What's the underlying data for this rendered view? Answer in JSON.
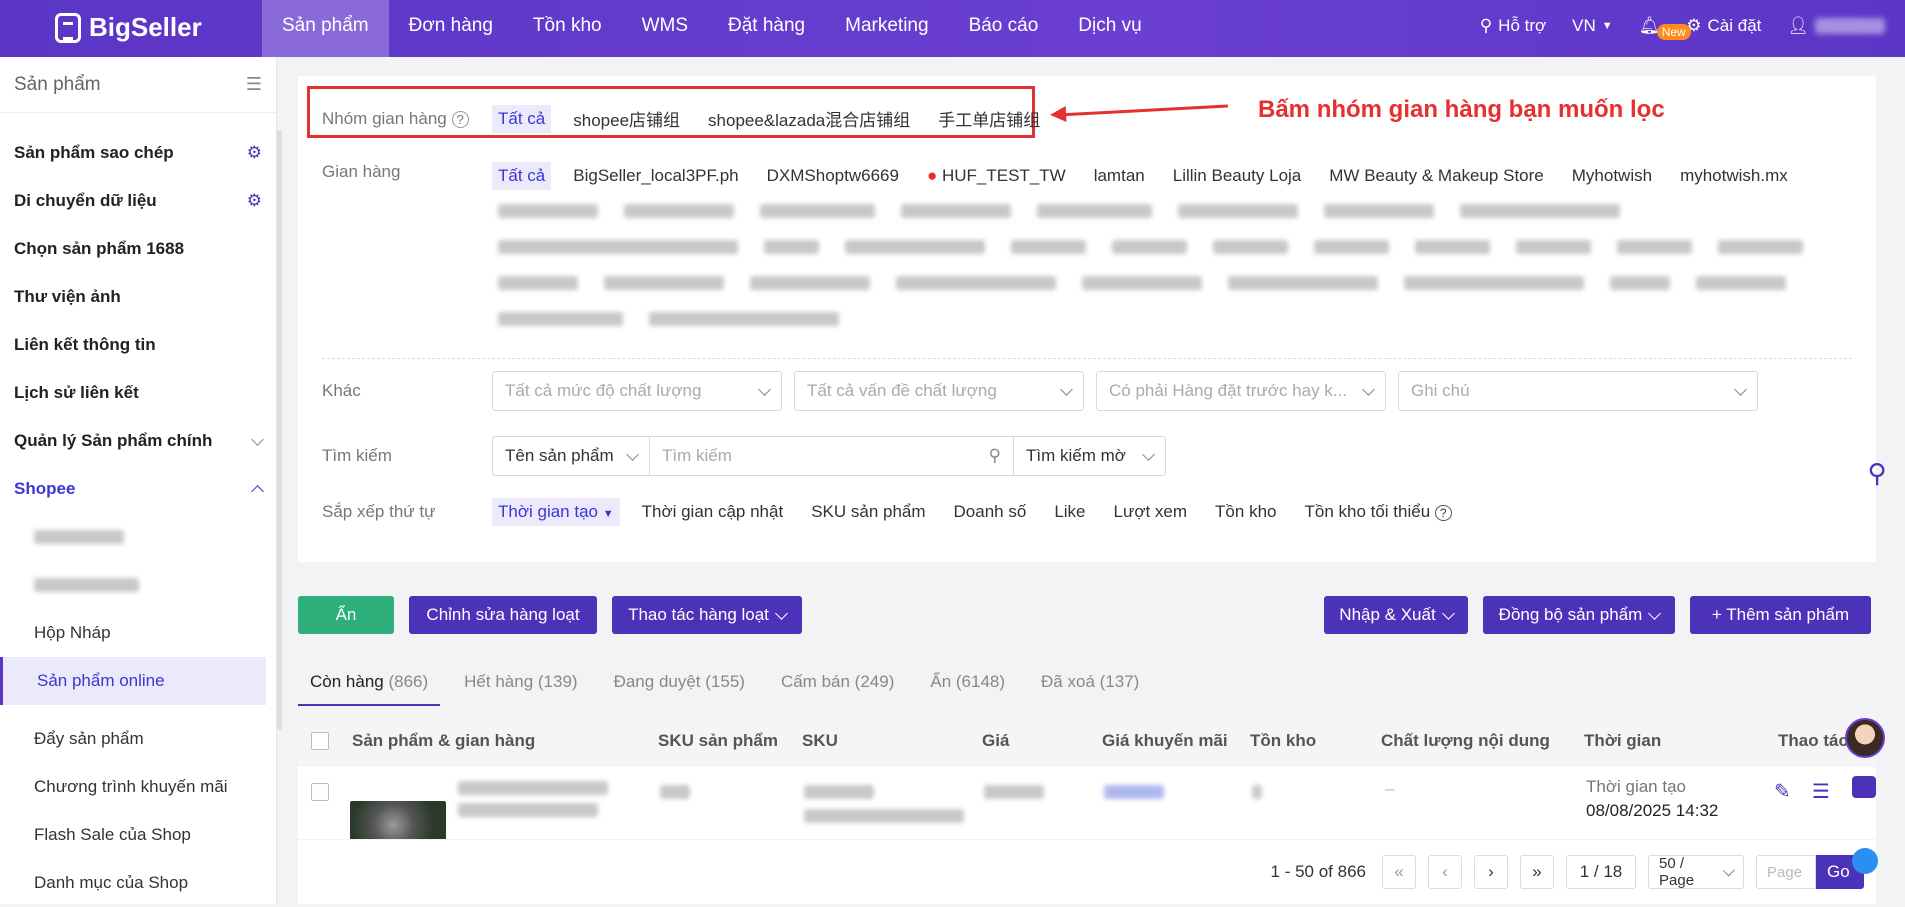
{
  "brand": "BigSeller",
  "nav": [
    "Sản phẩm",
    "Đơn hàng",
    "Tồn kho",
    "WMS",
    "Đặt hàng",
    "Marketing",
    "Báo cáo",
    "Dịch vụ"
  ],
  "topright": {
    "support": "Hỗ trợ",
    "lang": "VN",
    "new_badge": "New",
    "settings": "Cài đặt"
  },
  "sidebar": {
    "title": "Sản phẩm",
    "items": [
      "Sản phẩm sao chép",
      "Di chuyển dữ liệu",
      "Chọn sản phẩm 1688",
      "Thư viện ảnh",
      "Liên kết thông tin",
      "Lịch sử liên kết",
      "Quản lý Sản phẩm chính",
      "Shopee"
    ],
    "subs": [
      "Hộp Nháp",
      "Sản phẩm online",
      "Đẩy sản phẩm",
      "Chương trình khuyến mãi",
      "Flash Sale của Shop",
      "Danh mục của Shop"
    ]
  },
  "filters": {
    "group_label": "Nhóm gian hàng",
    "group_chips": [
      "Tất cả",
      "shopee店铺组",
      "shopee&lazada混合店铺组",
      "手工单店铺组"
    ],
    "annotation": "Bấm nhóm gian hàng bạn muốn lọc",
    "store_label": "Gian hàng",
    "store_chips": [
      "Tất cả",
      "BigSeller_local3PF.ph",
      "DXMShoptw6669",
      "HUF_TEST_TW",
      "lamtan",
      "Lillin Beauty Loja",
      "MW Beauty & Makeup Store",
      "Myhotwish",
      "myhotwish.mx"
    ],
    "other_label": "Khác",
    "other_selects": [
      "Tất cả mức độ chất lượng",
      "Tất cả vấn đề chất lượng",
      "Có phải Hàng đặt trước hay k...",
      "Ghi chú"
    ],
    "search_label": "Tìm kiếm",
    "search_field": "Tên sản phẩm",
    "search_placeholder": "Tìm kiếm",
    "search_mode": "Tìm kiếm mờ",
    "sort_label": "Sắp xếp thứ tự",
    "sort_chips": [
      "Thời gian tạo",
      "Thời gian cập nhật",
      "SKU sản phẩm",
      "Doanh số",
      "Like",
      "Lượt xem",
      "Tồn kho",
      "Tồn kho tối thiểu"
    ]
  },
  "toolbar": {
    "hide": "Ẩn",
    "bulk_edit": "Chỉnh sửa hàng loạt",
    "bulk_ops": "Thao tác hàng loạt",
    "import_export": "Nhập & Xuất",
    "sync": "Đồng bộ sản phẩm",
    "add": "+ Thêm sản phẩm"
  },
  "tabs": [
    {
      "label": "Còn hàng",
      "count": "(866)"
    },
    {
      "label": "Hết hàng",
      "count": "(139)"
    },
    {
      "label": "Đang duyệt",
      "count": "(155)"
    },
    {
      "label": "Cấm bán",
      "count": "(249)"
    },
    {
      "label": "Ẩn",
      "count": "(6148)"
    },
    {
      "label": "Đã xoá",
      "count": "(137)"
    }
  ],
  "table": {
    "headers": [
      "Sản phẩm & gian hàng",
      "SKU sản phẩm",
      "SKU",
      "Giá",
      "Giá khuyến mãi",
      "Tồn kho",
      "Chất lượng nội dung",
      "Thời gian",
      "Thao tác"
    ],
    "row": {
      "time_label": "Thời gian tạo",
      "time_value": "08/08/2025 14:32"
    }
  },
  "pagination": {
    "range": "1 - 50 of 866",
    "page": "1 / 18",
    "per_page": "50 / Page",
    "page_placeholder": "Page",
    "go": "Go"
  }
}
